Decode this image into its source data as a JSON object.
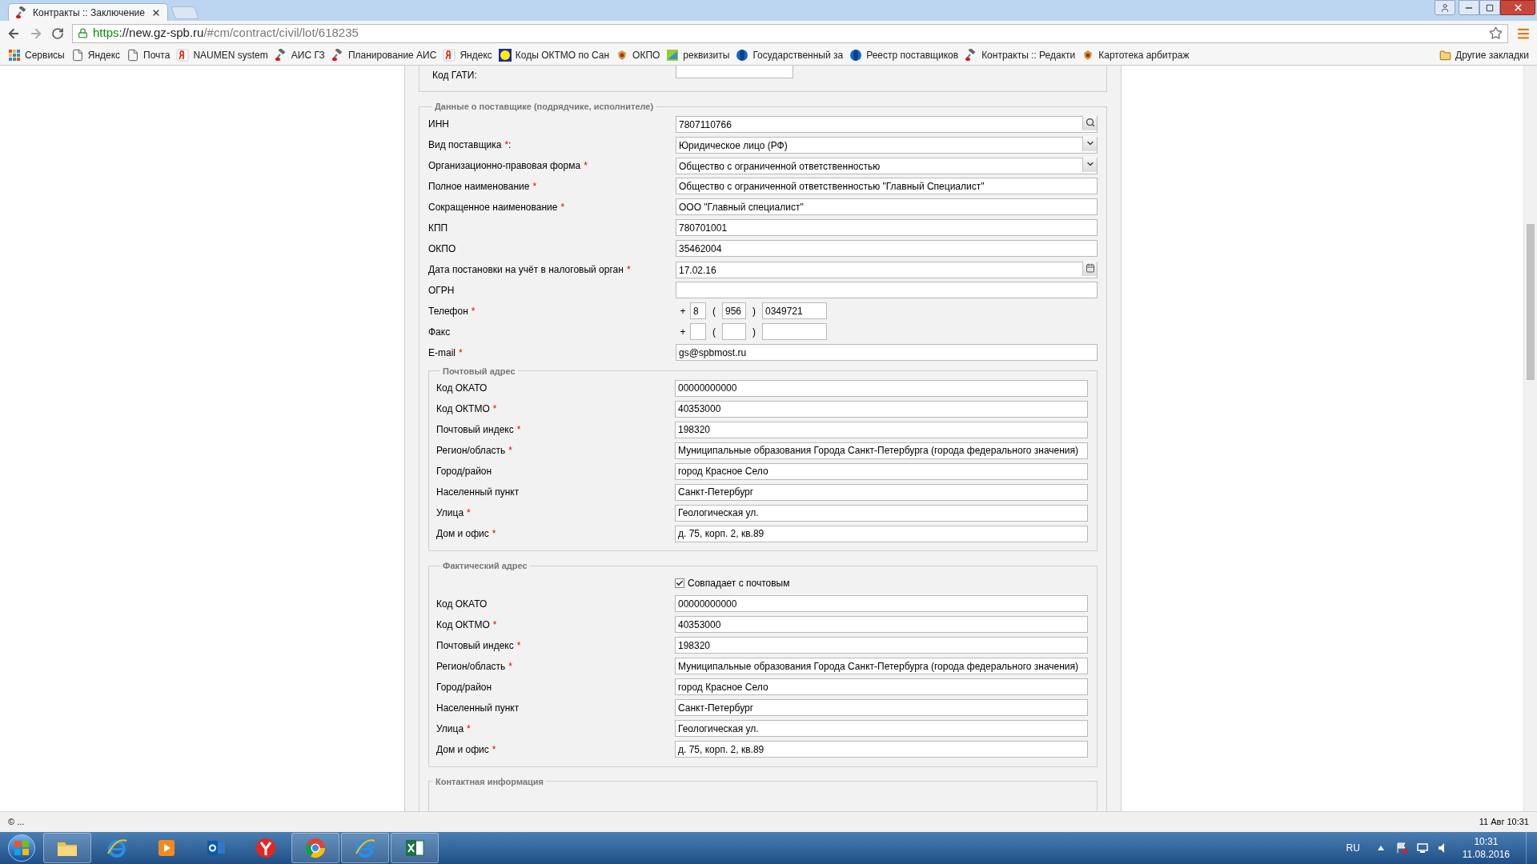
{
  "browser": {
    "tabs": [
      {
        "title": "Контракты :: Заключение",
        "selected": true
      }
    ],
    "url": {
      "scheme": "https",
      "host": "://new.gz-spb.ru",
      "path": "/#cm/contract/civil/lot/618235"
    },
    "bookmarks": [
      {
        "label": "Сервисы",
        "kind": "apps"
      },
      {
        "label": "Яндекс",
        "kind": "page"
      },
      {
        "label": "Почта",
        "kind": "page"
      },
      {
        "label": "NAUMEN system",
        "kind": "yandex"
      },
      {
        "label": "АИС ГЗ",
        "kind": "gavel"
      },
      {
        "label": "Планирование АИС",
        "kind": "gavel"
      },
      {
        "label": "Яндекс",
        "kind": "yandex"
      },
      {
        "label": "Коды ОКТМО по Сан",
        "kind": "dot"
      },
      {
        "label": "ОКПО",
        "kind": "emblem"
      },
      {
        "label": "реквизиты",
        "kind": "chart"
      },
      {
        "label": "Государственный за",
        "kind": "globe"
      },
      {
        "label": "Реестр поставщиков",
        "kind": "globe"
      },
      {
        "label": "Контракты :: Редакти",
        "kind": "gavel"
      },
      {
        "label": "Картотека арбитраж",
        "kind": "emblem"
      }
    ],
    "other_bookmarks": "Другие закладки"
  },
  "form": {
    "top_field": {
      "label": "Код ГАТИ:"
    },
    "supplier": {
      "legend": "Данные о поставщике (подрядчике, исполнителе)",
      "fields": [
        {
          "kind": "search",
          "label": "ИНН",
          "value": "7807110766"
        },
        {
          "kind": "select",
          "label": "Вид поставщика",
          "required_mark": "*",
          "suffix": ":",
          "value": "Юридическое лицо (РФ)"
        },
        {
          "kind": "select",
          "label": "Организационно-правовая форма",
          "required_mark": "*",
          "value": "Общество с ограниченной ответственностью"
        },
        {
          "kind": "text",
          "label": "Полное наименование",
          "required_mark": "*",
          "value": "Общество с ограниченной ответственностью \"Главный Специалист\""
        },
        {
          "kind": "text",
          "label": "Сокращенное наименование",
          "required_mark": "*",
          "value": "ООО \"Главный специалист\""
        },
        {
          "kind": "text",
          "label": "КПП",
          "value": "780701001"
        },
        {
          "kind": "text",
          "label": "ОКПО",
          "value": "35462004"
        },
        {
          "kind": "date",
          "label": "Дата постановки на учёт в налоговый орган",
          "required_mark": "*",
          "value": "17.02.16"
        },
        {
          "kind": "text",
          "label": "ОГРН"
        },
        {
          "kind": "phone",
          "label": "Телефон",
          "required_mark": "*",
          "plus": "+",
          "open": "(",
          "close": ")",
          "parts": {
            "country": "8",
            "area": "956",
            "number": "0349721"
          }
        },
        {
          "kind": "phone",
          "label": "Факс",
          "plus": "+",
          "open": "(",
          "close": ")"
        },
        {
          "kind": "text",
          "label": "E-mail",
          "required_mark": "*",
          "value": "gs@spbmost.ru"
        }
      ]
    },
    "postal_address": {
      "legend": "Почтовый адрес",
      "fields": [
        {
          "kind": "text",
          "label": "Код ОКАТО",
          "value": "00000000000"
        },
        {
          "kind": "text",
          "label": "Код ОКТМО",
          "required_mark": "*",
          "value": "40353000"
        },
        {
          "kind": "text",
          "label": "Почтовый индекс",
          "required_mark": "*",
          "value": "198320"
        },
        {
          "kind": "text",
          "label": "Регион/область",
          "required_mark": "*",
          "value": "Муниципальные образования Города Санкт-Петербурга (города федерального значения)"
        },
        {
          "kind": "text",
          "label": "Город/район",
          "value": "город Красное Село"
        },
        {
          "kind": "text",
          "label": "Населенный пункт",
          "value": "Санкт-Петербург"
        },
        {
          "kind": "text",
          "label": "Улица",
          "required_mark": "*",
          "value": "Геологическая ул."
        },
        {
          "kind": "text",
          "label": "Дом и офис",
          "required_mark": "*",
          "value": "д. 75, корп. 2, кв.89"
        }
      ]
    },
    "actual_address": {
      "legend": "Фактический адрес",
      "fields": [
        {
          "kind": "checkbox",
          "label": "Совпадает с почтовым",
          "checked": true
        },
        {
          "kind": "text",
          "label": "Код ОКАТО",
          "value": "00000000000"
        },
        {
          "kind": "text",
          "label": "Код ОКТМО",
          "required_mark": "*",
          "value": "40353000"
        },
        {
          "kind": "text",
          "label": "Почтовый индекс",
          "required_mark": "*",
          "value": "198320"
        },
        {
          "kind": "text",
          "label": "Регион/область",
          "required_mark": "*",
          "value": "Муниципальные образования Города Санкт-Петербурга (города федерального значения)"
        },
        {
          "kind": "text",
          "label": "Город/район",
          "value": "город Красное Село"
        },
        {
          "kind": "text",
          "label": "Населенный пункт",
          "value": "Санкт-Петербург"
        },
        {
          "kind": "text",
          "label": "Улица",
          "required_mark": "*",
          "value": "Геологическая ул."
        },
        {
          "kind": "text",
          "label": "Дом и офис",
          "required_mark": "*",
          "value": "д. 75, корп. 2, кв.89"
        }
      ]
    },
    "contact": {
      "legend": "Контактная информация"
    }
  },
  "status_bar": {
    "left": "© ...",
    "right": "11 Авг 10:31"
  },
  "taskbar": {
    "apps": [
      {
        "kind": "folder",
        "running": true
      },
      {
        "kind": "ie",
        "running": false
      },
      {
        "kind": "media",
        "running": false
      },
      {
        "kind": "outlook",
        "running": false
      },
      {
        "kind": "yandex",
        "running": false
      },
      {
        "kind": "chrome",
        "running": true
      },
      {
        "kind": "ie",
        "running": true
      },
      {
        "kind": "excel",
        "running": true
      }
    ],
    "language": "RU",
    "time": "10:31",
    "date": "11.08.2016"
  }
}
